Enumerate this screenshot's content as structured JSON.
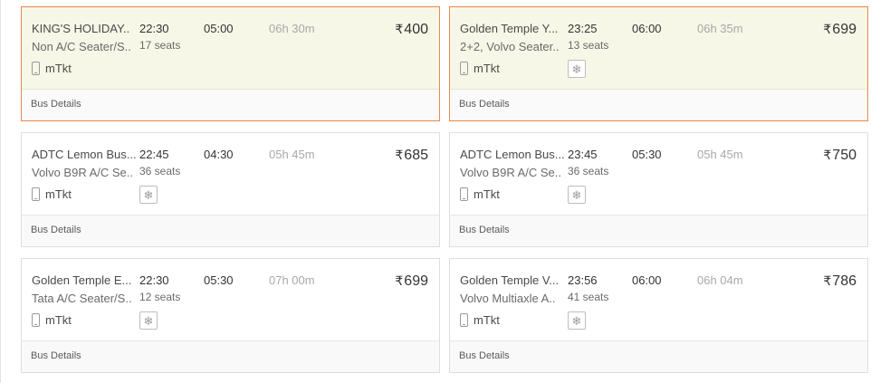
{
  "common": {
    "bus_details_label": "Bus Details",
    "mticket_label": "mTkt",
    "currency_symbol": "₹",
    "icons": {
      "mticket": "mobile-phone-icon",
      "ac": "snowflake-icon"
    }
  },
  "buses": [
    {
      "operator": "KING'S HOLIDAY..",
      "bus_type": "Non A/C Seater/S..",
      "departure": "22:30",
      "arrival": "05:00",
      "duration": "06h 30m",
      "seats": "17 seats",
      "price": "400",
      "ac": false,
      "selected": true
    },
    {
      "operator": "Golden Temple Y...",
      "bus_type": "2+2, Volvo Seater..",
      "departure": "23:25",
      "arrival": "06:00",
      "duration": "06h 35m",
      "seats": "13 seats",
      "price": "699",
      "ac": true,
      "selected": true
    },
    {
      "operator": "ADTC Lemon Bus...",
      "bus_type": "Volvo B9R A/C Se..",
      "departure": "22:45",
      "arrival": "04:30",
      "duration": "05h 45m",
      "seats": "36 seats",
      "price": "685",
      "ac": true,
      "selected": false
    },
    {
      "operator": "ADTC Lemon Bus...",
      "bus_type": "Volvo B9R A/C Se..",
      "departure": "23:45",
      "arrival": "05:30",
      "duration": "05h 45m",
      "seats": "36 seats",
      "price": "750",
      "ac": true,
      "selected": false
    },
    {
      "operator": "Golden Temple E...",
      "bus_type": "Tata A/C Seater/S..",
      "departure": "22:30",
      "arrival": "05:30",
      "duration": "07h 00m",
      "seats": "12 seats",
      "price": "699",
      "ac": true,
      "selected": false
    },
    {
      "operator": "Golden Temple V...",
      "bus_type": "Volvo Multiaxle A..",
      "departure": "23:56",
      "arrival": "06:00",
      "duration": "06h 04m",
      "seats": "41 seats",
      "price": "786",
      "ac": true,
      "selected": false
    }
  ]
}
